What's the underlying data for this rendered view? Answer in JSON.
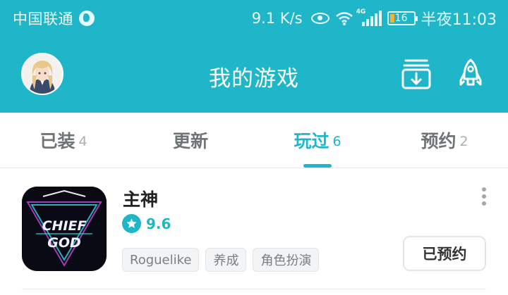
{
  "status_bar": {
    "carrier": "中国联通",
    "net_speed": "9.1 K/s",
    "network_label": "4G",
    "battery": "16",
    "time": "半夜11:03"
  },
  "header": {
    "title": "我的游戏"
  },
  "tabs": [
    {
      "label": "已装",
      "count": "4"
    },
    {
      "label": "更新",
      "count": ""
    },
    {
      "label": "玩过",
      "count": "6",
      "active": true
    },
    {
      "label": "预约",
      "count": "2"
    }
  ],
  "game": {
    "title": "主神",
    "rating": "9.6",
    "icon_text_line1": "CHIEF",
    "icon_text_line2": "GOD",
    "tags": [
      "Roguelike",
      "养成",
      "角色扮演"
    ],
    "action_label": "已预约"
  },
  "colors": {
    "accent": "#1eb6c8",
    "battery_warning": "#f7b233"
  }
}
